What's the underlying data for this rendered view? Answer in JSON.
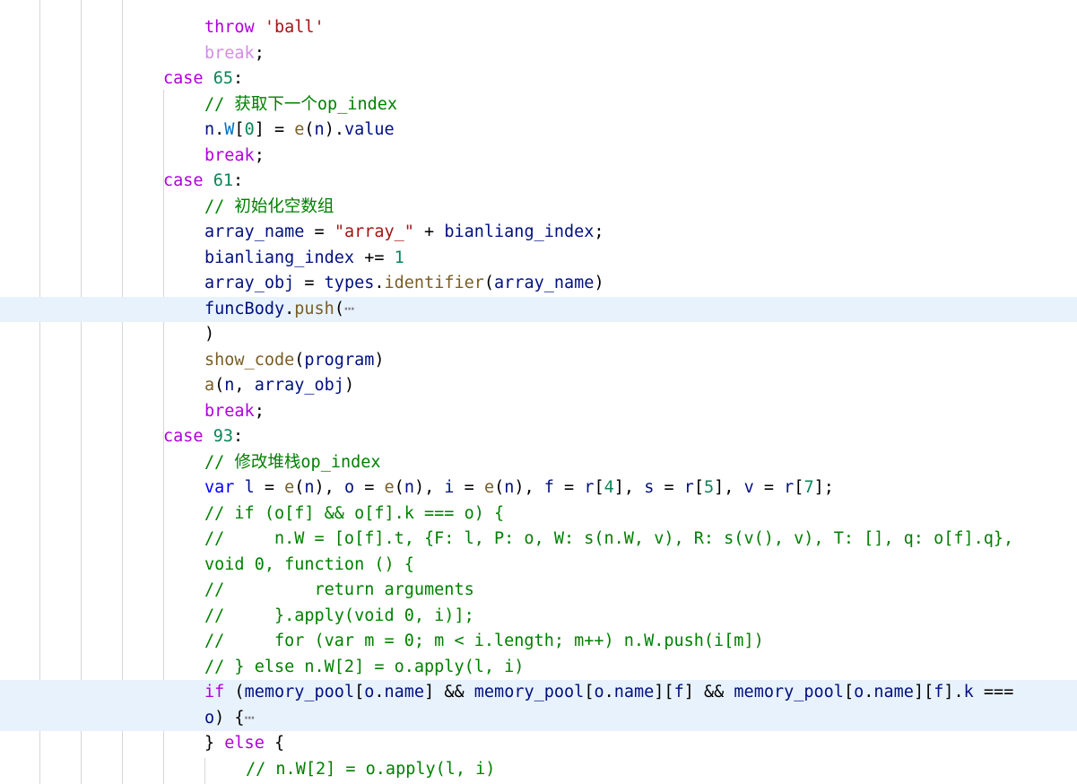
{
  "editor": {
    "lines": [
      [
        {
          "t": "throw",
          "c": "kw-ctrl"
        },
        {
          "t": " ",
          "c": ""
        },
        {
          "t": "'ball'",
          "c": "str"
        }
      ],
      [
        {
          "t": "break",
          "c": "kw-ctrl-dim"
        },
        {
          "t": ";",
          "c": ""
        }
      ],
      [
        {
          "t": "case",
          "c": "kw-ctrl"
        },
        {
          "t": " ",
          "c": ""
        },
        {
          "t": "65",
          "c": "num"
        },
        {
          "t": ":",
          "c": ""
        }
      ],
      [
        {
          "t": "// 获取下一个op_index",
          "c": "cmt"
        }
      ],
      [
        {
          "t": "n",
          "c": "var"
        },
        {
          "t": ".",
          "c": ""
        },
        {
          "t": "W",
          "c": "prop"
        },
        {
          "t": "[",
          "c": ""
        },
        {
          "t": "0",
          "c": "num"
        },
        {
          "t": "] = ",
          "c": ""
        },
        {
          "t": "e",
          "c": "fn"
        },
        {
          "t": "(",
          "c": ""
        },
        {
          "t": "n",
          "c": "var"
        },
        {
          "t": ").",
          "c": ""
        },
        {
          "t": "value",
          "c": "var"
        }
      ],
      [
        {
          "t": "break",
          "c": "kw-ctrl"
        },
        {
          "t": ";",
          "c": ""
        }
      ],
      [
        {
          "t": "case",
          "c": "kw-ctrl"
        },
        {
          "t": " ",
          "c": ""
        },
        {
          "t": "61",
          "c": "num"
        },
        {
          "t": ":",
          "c": ""
        }
      ],
      [
        {
          "t": "// 初始化空数组",
          "c": "cmt"
        }
      ],
      [
        {
          "t": "array_name",
          "c": "var"
        },
        {
          "t": " = ",
          "c": ""
        },
        {
          "t": "\"array_\"",
          "c": "str"
        },
        {
          "t": " + ",
          "c": ""
        },
        {
          "t": "bianliang_index",
          "c": "var"
        },
        {
          "t": ";",
          "c": ""
        }
      ],
      [
        {
          "t": "bianliang_index",
          "c": "var"
        },
        {
          "t": " += ",
          "c": ""
        },
        {
          "t": "1",
          "c": "num"
        }
      ],
      [
        {
          "t": "array_obj",
          "c": "var"
        },
        {
          "t": " = ",
          "c": ""
        },
        {
          "t": "types",
          "c": "var"
        },
        {
          "t": ".",
          "c": ""
        },
        {
          "t": "identifier",
          "c": "fn"
        },
        {
          "t": "(",
          "c": ""
        },
        {
          "t": "array_name",
          "c": "var"
        },
        {
          "t": ")",
          "c": ""
        }
      ],
      [
        {
          "t": "funcBody",
          "c": "var"
        },
        {
          "t": ".",
          "c": ""
        },
        {
          "t": "push",
          "c": "fn"
        },
        {
          "t": "(",
          "c": ""
        },
        {
          "t": "⋯",
          "c": "fold"
        }
      ],
      [
        {
          "t": ")",
          "c": ""
        }
      ],
      [
        {
          "t": "show_code",
          "c": "fn"
        },
        {
          "t": "(",
          "c": ""
        },
        {
          "t": "program",
          "c": "var"
        },
        {
          "t": ")",
          "c": ""
        }
      ],
      [
        {
          "t": "a",
          "c": "fn"
        },
        {
          "t": "(",
          "c": ""
        },
        {
          "t": "n",
          "c": "var"
        },
        {
          "t": ", ",
          "c": ""
        },
        {
          "t": "array_obj",
          "c": "var"
        },
        {
          "t": ")",
          "c": ""
        }
      ],
      [
        {
          "t": "break",
          "c": "kw-ctrl"
        },
        {
          "t": ";",
          "c": ""
        }
      ],
      [
        {
          "t": "case",
          "c": "kw-ctrl"
        },
        {
          "t": " ",
          "c": ""
        },
        {
          "t": "93",
          "c": "num"
        },
        {
          "t": ":",
          "c": ""
        }
      ],
      [
        {
          "t": "// 修改堆栈op_index",
          "c": "cmt"
        }
      ],
      [
        {
          "t": "var",
          "c": "kw"
        },
        {
          "t": " ",
          "c": ""
        },
        {
          "t": "l",
          "c": "var"
        },
        {
          "t": " = ",
          "c": ""
        },
        {
          "t": "e",
          "c": "fn"
        },
        {
          "t": "(",
          "c": ""
        },
        {
          "t": "n",
          "c": "var"
        },
        {
          "t": "), ",
          "c": ""
        },
        {
          "t": "o",
          "c": "var"
        },
        {
          "t": " = ",
          "c": ""
        },
        {
          "t": "e",
          "c": "fn"
        },
        {
          "t": "(",
          "c": ""
        },
        {
          "t": "n",
          "c": "var"
        },
        {
          "t": "), ",
          "c": ""
        },
        {
          "t": "i",
          "c": "var"
        },
        {
          "t": " = ",
          "c": ""
        },
        {
          "t": "e",
          "c": "fn"
        },
        {
          "t": "(",
          "c": ""
        },
        {
          "t": "n",
          "c": "var"
        },
        {
          "t": "), ",
          "c": ""
        },
        {
          "t": "f",
          "c": "var"
        },
        {
          "t": " = ",
          "c": ""
        },
        {
          "t": "r",
          "c": "var"
        },
        {
          "t": "[",
          "c": ""
        },
        {
          "t": "4",
          "c": "num"
        },
        {
          "t": "], ",
          "c": ""
        },
        {
          "t": "s",
          "c": "var"
        },
        {
          "t": " = ",
          "c": ""
        },
        {
          "t": "r",
          "c": "var"
        },
        {
          "t": "[",
          "c": ""
        },
        {
          "t": "5",
          "c": "num"
        },
        {
          "t": "], ",
          "c": ""
        },
        {
          "t": "v",
          "c": "var"
        },
        {
          "t": " = ",
          "c": ""
        },
        {
          "t": "r",
          "c": "var"
        },
        {
          "t": "[",
          "c": ""
        },
        {
          "t": "7",
          "c": "num"
        },
        {
          "t": "];",
          "c": ""
        }
      ],
      [
        {
          "t": "// if (o[f] && o[f].k === o) {",
          "c": "cmt"
        }
      ],
      [
        {
          "t": "//     n.W = [o[f].t, {F: l, P: o, W: s(n.W, v), R: s(v(), v), T: [], q: o[f].q},",
          "c": "cmt"
        }
      ],
      [
        {
          "t": "void 0, function () {",
          "c": "cmt"
        }
      ],
      [
        {
          "t": "//         return arguments",
          "c": "cmt"
        }
      ],
      [
        {
          "t": "//     }.apply(void 0, i)];",
          "c": "cmt"
        }
      ],
      [
        {
          "t": "//     for (var m = 0; m < i.length; m++) n.W.push(i[m])",
          "c": "cmt"
        }
      ],
      [
        {
          "t": "// } else n.W[2] = o.apply(l, i)",
          "c": "cmt"
        }
      ],
      [
        {
          "t": "if",
          "c": "kw-ctrl"
        },
        {
          "t": " (",
          "c": ""
        },
        {
          "t": "memory_pool",
          "c": "var"
        },
        {
          "t": "[",
          "c": ""
        },
        {
          "t": "o",
          "c": "var"
        },
        {
          "t": ".",
          "c": ""
        },
        {
          "t": "name",
          "c": "var"
        },
        {
          "t": "] && ",
          "c": ""
        },
        {
          "t": "memory_pool",
          "c": "var"
        },
        {
          "t": "[",
          "c": ""
        },
        {
          "t": "o",
          "c": "var"
        },
        {
          "t": ".",
          "c": ""
        },
        {
          "t": "name",
          "c": "var"
        },
        {
          "t": "][",
          "c": ""
        },
        {
          "t": "f",
          "c": "var"
        },
        {
          "t": "] && ",
          "c": ""
        },
        {
          "t": "memory_pool",
          "c": "var"
        },
        {
          "t": "[",
          "c": ""
        },
        {
          "t": "o",
          "c": "var"
        },
        {
          "t": ".",
          "c": ""
        },
        {
          "t": "name",
          "c": "var"
        },
        {
          "t": "][",
          "c": ""
        },
        {
          "t": "f",
          "c": "var"
        },
        {
          "t": "].",
          "c": ""
        },
        {
          "t": "k",
          "c": "var"
        },
        {
          "t": " ===",
          "c": ""
        }
      ],
      [
        {
          "t": "o",
          "c": "var"
        },
        {
          "t": ") {",
          "c": ""
        },
        {
          "t": "⋯",
          "c": "fold"
        }
      ],
      [
        {
          "t": "} ",
          "c": ""
        },
        {
          "t": "else",
          "c": "kw-ctrl"
        },
        {
          "t": " {",
          "c": ""
        }
      ],
      [
        {
          "t": "// n.W[2] = o.apply(l, i)",
          "c": "cmt"
        }
      ]
    ]
  }
}
